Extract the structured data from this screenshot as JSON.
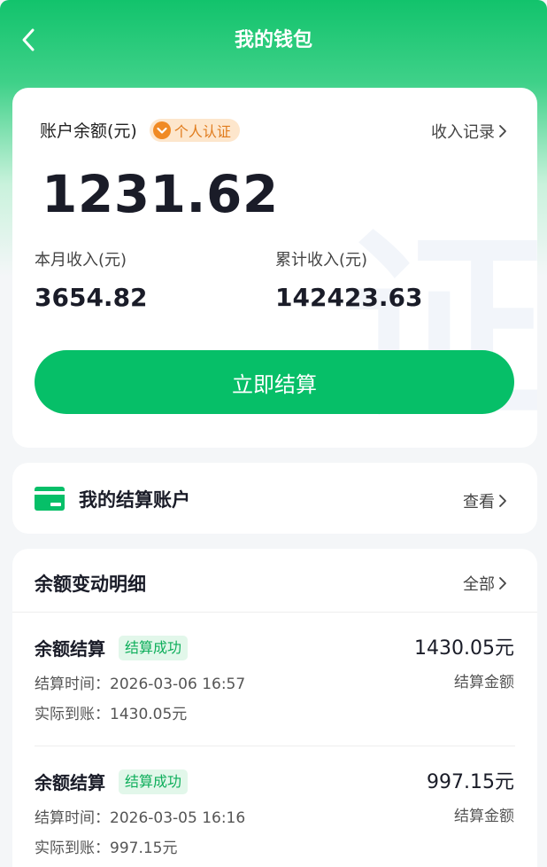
{
  "header": {
    "title": "我的钱包",
    "back_icon": "chevron-left-icon"
  },
  "balance_card": {
    "balance_label": "账户余额(元)",
    "verify_badge": "个人认证",
    "income_record_link": "收入记录",
    "balance_value": "1231.62",
    "watermark": "证",
    "month_income_label": "本月收入(元)",
    "month_income_value": "3654.82",
    "total_income_label": "累计收入(元)",
    "total_income_value": "142423.63",
    "settle_button": "立即结算"
  },
  "account_card": {
    "title": "我的结算账户",
    "view_link": "查看",
    "icon": "card-icon"
  },
  "details": {
    "title": "余额变动明细",
    "all_link": "全部",
    "items": [
      {
        "title": "余额结算",
        "status": "结算成功",
        "amount": "1430.05元",
        "amount_label": "结算金额",
        "time": "结算时间：2026-03-06 16:57",
        "received": "实际到账：1430.05元"
      },
      {
        "title": "余额结算",
        "status": "结算成功",
        "amount": "997.15元",
        "amount_label": "结算金额",
        "time": "结算时间：2026-03-05 16:16",
        "received": "实际到账：997.15元"
      }
    ]
  },
  "colors": {
    "primary": "#06bf68",
    "badge_orange": "#f08a24",
    "text_dark": "#1a1c28"
  }
}
